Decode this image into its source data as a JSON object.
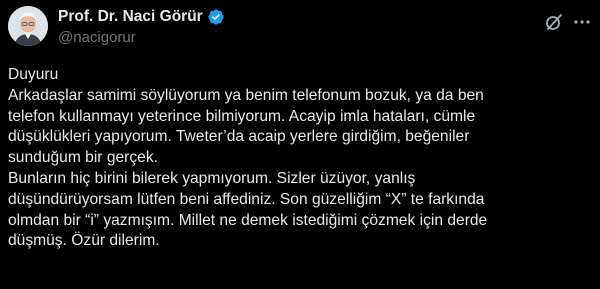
{
  "author": {
    "display_name": "Prof. Dr. Naci Görür",
    "handle": "@nacigorur",
    "verified": true
  },
  "icons": {
    "verified": "verified-badge-icon",
    "grok": "grok-icon",
    "more": "more-options-icon"
  },
  "colors": {
    "background": "#000000",
    "text_primary": "#e7e9ea",
    "text_secondary": "#71767b",
    "verified_blue": "#1d9bf0"
  },
  "post": {
    "lines": [
      "Duyuru",
      "Arkadaşlar samimi söylüyorum ya benim telefonum bozuk, ya da ben",
      "telefon kullanmayı yeterince bilmiyorum. Acayip imla hataları, cümle",
      "düşüklükleri yapıyorum. Tweter’da acaip yerlere girdiğim, beğeniler",
      "sunduğum bir gerçek.",
      "Bunların hiç birini bilerek yapmıyorum. Sizler üzüyor, yanlış",
      "düşündürüyorsam lütfen beni affediniz. Son güzelliğim “X” te farkında",
      "olmdan bir “i” yazmışım. Millet ne demek istediğimi çözmek için derde",
      "düşmüş. Özür dilerim."
    ]
  }
}
